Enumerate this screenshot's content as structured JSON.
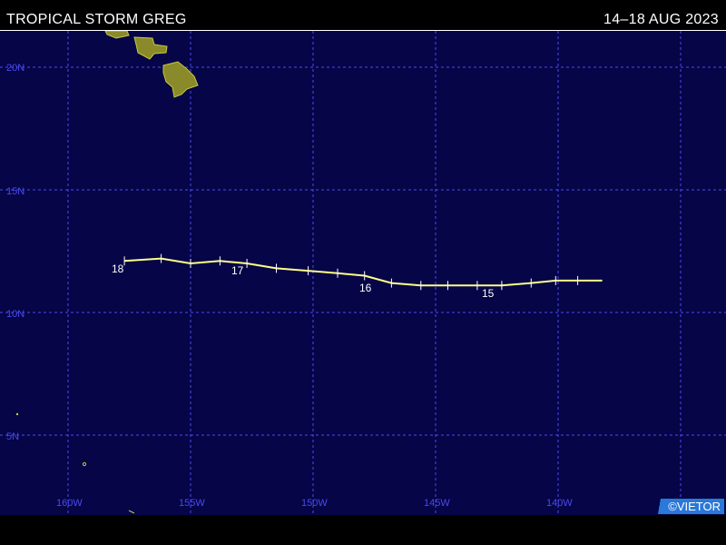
{
  "header": {
    "title": "TROPICAL STORM GREG",
    "dates": "14–18 AUG 2023"
  },
  "map": {
    "lat_labels": [
      "20N",
      "15N",
      "10N",
      "5N"
    ],
    "lon_labels": [
      "160W",
      "155W",
      "150W",
      "145W",
      "140W"
    ],
    "colors": {
      "ocean": "#050547",
      "grid": "#4a4af0",
      "land": "#8a8a2a",
      "track": "#ffff88"
    },
    "land_features": [
      "hawaiian-islands"
    ]
  },
  "storm": {
    "name": "GREG",
    "day_labels": [
      "18",
      "17",
      "16",
      "15"
    ],
    "track": [
      {
        "lon": -138.2,
        "lat": 11.3
      },
      {
        "lon": -139.2,
        "lat": 11.3
      },
      {
        "lon": -140.1,
        "lat": 11.3
      },
      {
        "lon": -141.1,
        "lat": 11.2
      },
      {
        "lon": -142.3,
        "lat": 11.1
      },
      {
        "lon": -143.3,
        "lat": 11.1
      },
      {
        "lon": -144.5,
        "lat": 11.1
      },
      {
        "lon": -145.6,
        "lat": 11.1
      },
      {
        "lon": -146.8,
        "lat": 11.2
      },
      {
        "lon": -147.9,
        "lat": 11.5
      },
      {
        "lon": -149.0,
        "lat": 11.6
      },
      {
        "lon": -150.2,
        "lat": 11.7
      },
      {
        "lon": -151.5,
        "lat": 11.8
      },
      {
        "lon": -152.7,
        "lat": 12.0
      },
      {
        "lon": -153.8,
        "lat": 12.1
      },
      {
        "lon": -155.0,
        "lat": 12.0
      },
      {
        "lon": -156.2,
        "lat": 12.2
      },
      {
        "lon": -157.7,
        "lat": 12.1
      }
    ]
  },
  "credit": "©VIETOR"
}
